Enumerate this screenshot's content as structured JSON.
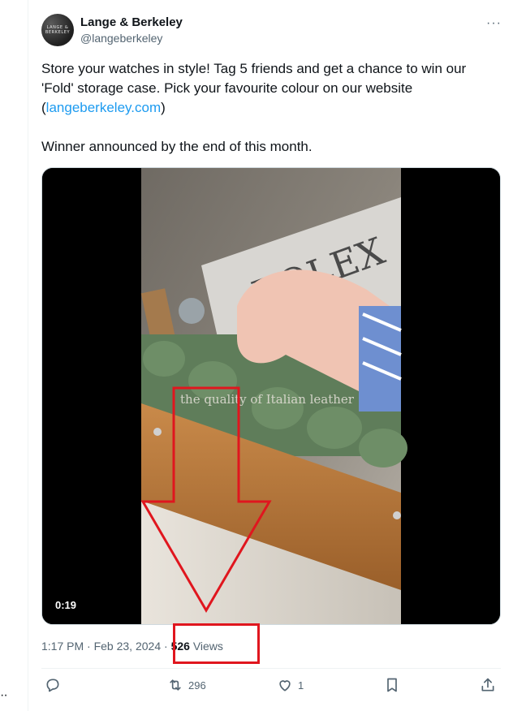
{
  "left_rail": {
    "dots": "··"
  },
  "author": {
    "avatar_text_line1": "LANGE &",
    "avatar_text_line2": "BERKELEY",
    "name": "Lange & Berkeley",
    "handle": "@langeberkeley"
  },
  "more_label": "···",
  "tweet": {
    "text_part1": "Store your watches in style! Tag 5 friends and get a chance to win our 'Fold' storage case. Pick your favourite colour on our website (",
    "link": "langeberkeley.com",
    "text_part2": ")",
    "text_line2": "Winner announced by the end of this month."
  },
  "media": {
    "duration": "0:19",
    "caption_overlay": "the quality of Italian leather",
    "book_text": "ROLEX"
  },
  "meta": {
    "time": "1:17 PM",
    "sep1": "·",
    "date": "Feb 23, 2024",
    "sep2": "·",
    "views_count": "526",
    "views_label": "Views"
  },
  "actions": {
    "reply_icon": "reply-icon",
    "retweet_count": "296",
    "like_count": "1",
    "bookmark_icon": "bookmark-icon",
    "share_icon": "share-icon"
  },
  "colors": {
    "accent": "#1d9bf0",
    "annotation": "#e0161e",
    "muted": "#536471"
  }
}
